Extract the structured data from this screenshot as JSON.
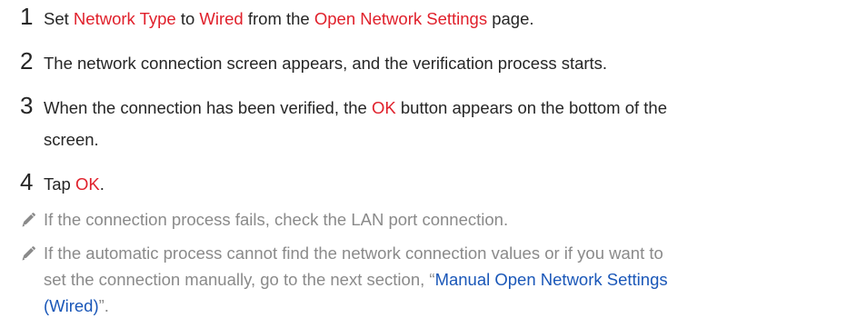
{
  "steps": [
    {
      "num": "1",
      "parts": {
        "a": "Set ",
        "b": "Network Type",
        "c": " to ",
        "d": "Wired",
        "e": " from the ",
        "f": "Open Network Settings",
        "g": " page."
      }
    },
    {
      "num": "2",
      "text": "The network connection screen appears, and the verification process starts."
    },
    {
      "num": "3",
      "parts": {
        "a": "When the connection has been verified, the ",
        "b": "OK",
        "c": " button appears on the bottom of the",
        "d": "screen."
      }
    },
    {
      "num": "4",
      "parts": {
        "a": "Tap ",
        "b": "OK",
        "c": "."
      }
    }
  ],
  "notes": [
    {
      "icon": "pencil-icon",
      "text": "If the connection process fails, check the LAN port connection."
    },
    {
      "icon": "pencil-icon",
      "parts": {
        "a": "If the automatic process cannot find the network connection values or if you want to",
        "b": "set the connection manually, go to the next section, “",
        "c": "Manual Open Network Settings",
        "d": "(Wired)",
        "e": "”."
      }
    }
  ],
  "colors": {
    "highlight_red": "#e0202b",
    "link_blue": "#1a57b8",
    "body_text": "#262626",
    "note_text": "#8a8a8a"
  }
}
